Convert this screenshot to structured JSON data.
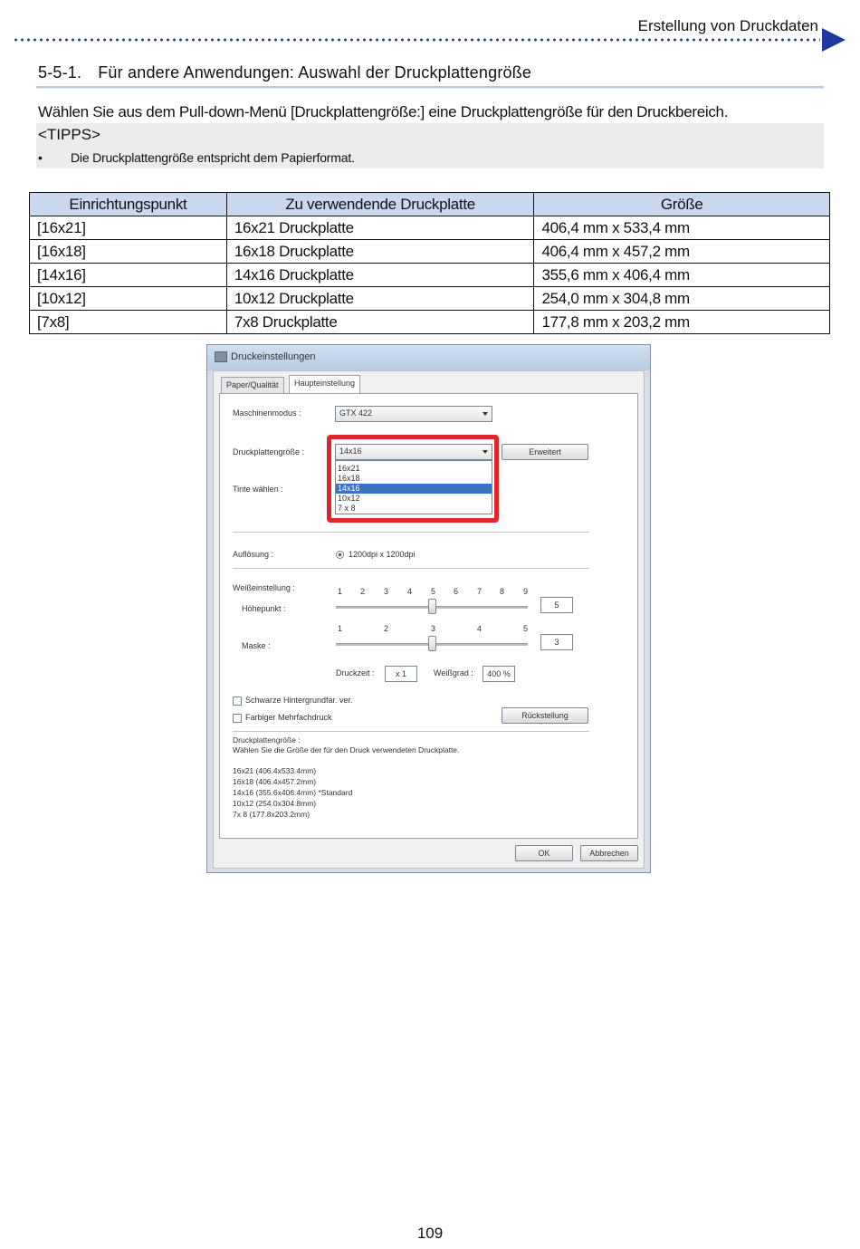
{
  "header": {
    "title": "Erstellung von Druckdaten",
    "accent": "#1c3aa0"
  },
  "section": {
    "number": "5-5-1.",
    "title": "Für andere Anwendungen: Auswahl der Druckplattengröße"
  },
  "intro": "Wählen Sie aus dem Pull-down-Menü [Druckplattengröße:] eine Druckplattengröße für den Druckbereich.",
  "tips": {
    "heading": "<TIPPS>",
    "bullet": "•",
    "items": [
      "Die Druckplattengröße entspricht dem Papierformat."
    ]
  },
  "table": {
    "headers": [
      "Einrichtungspunkt",
      "Zu verwendende Druckplatte",
      "Größe"
    ],
    "rows": [
      [
        "[16x21]",
        "16x21 Druckplatte",
        "406,4 mm x 533,4 mm"
      ],
      [
        "[16x18]",
        "16x18 Druckplatte",
        "406,4 mm x 457,2 mm"
      ],
      [
        "[14x16]",
        "14x16 Druckplatte",
        "355,6 mm x 406,4 mm"
      ],
      [
        "[10x12]",
        "10x12 Druckplatte",
        "254,0 mm x 304,8 mm"
      ],
      [
        "[7x8]",
        "7x8 Druckplatte",
        "177,8 mm x 203,2 mm"
      ]
    ]
  },
  "dialog": {
    "title": "Druckeinstellungen",
    "tabs": [
      "Paper/Qualität",
      "Haupteinstellung"
    ],
    "machine_label": "Maschinenmodus :",
    "machine_value": "GTX 422",
    "plate_label": "Druckplattengröße :",
    "plate_value": "14x16",
    "plate_options": [
      "16x21",
      "16x18",
      "14x16",
      "10x12",
      "7 x 8"
    ],
    "plate_selected_index": 2,
    "extended_button": "Erweitert",
    "ink_label": "Tinte wählen :",
    "resolution_label": "Auflösung :",
    "resolution_value": "1200dpi x 1200dpi",
    "white_label": "Weißeinstellung :",
    "highlight_label": "Höhepunkt :",
    "highlight_ticks": [
      "1",
      "2",
      "3",
      "4",
      "5",
      "6",
      "7",
      "8",
      "9"
    ],
    "highlight_value": "5",
    "mask_label": "Maske :",
    "mask_ticks": [
      "1",
      "2",
      "3",
      "4",
      "5"
    ],
    "mask_value": "3",
    "print_time_label": "Druckzeit :",
    "print_time_value": "x 1",
    "whiteness_label": "Weißgrad :",
    "whiteness_value": "400 %",
    "check_black_bg": "Schwarze Hintergrundfar. ver.",
    "check_color_multi": "Farbiger Mehrfachdruck",
    "reset_button": "Rückstellung",
    "info_title": "Druckplattengröße :",
    "info_desc": "Wählen Sie die Größe der für den Druck verwendeten Druckplatte.",
    "info_lines": [
      "16x21 (406.4x533.4mm)",
      "16x18 (406.4x457.2mm)",
      "14x16 (355.6x406.4mm) *Standard",
      "10x12 (254.0x304.8mm)",
      "7x 8  (177.8x203.2mm)"
    ],
    "ok_button": "OK",
    "cancel_button": "Abbrechen",
    "highlight_color": "#e0262a"
  },
  "page_number": "109"
}
